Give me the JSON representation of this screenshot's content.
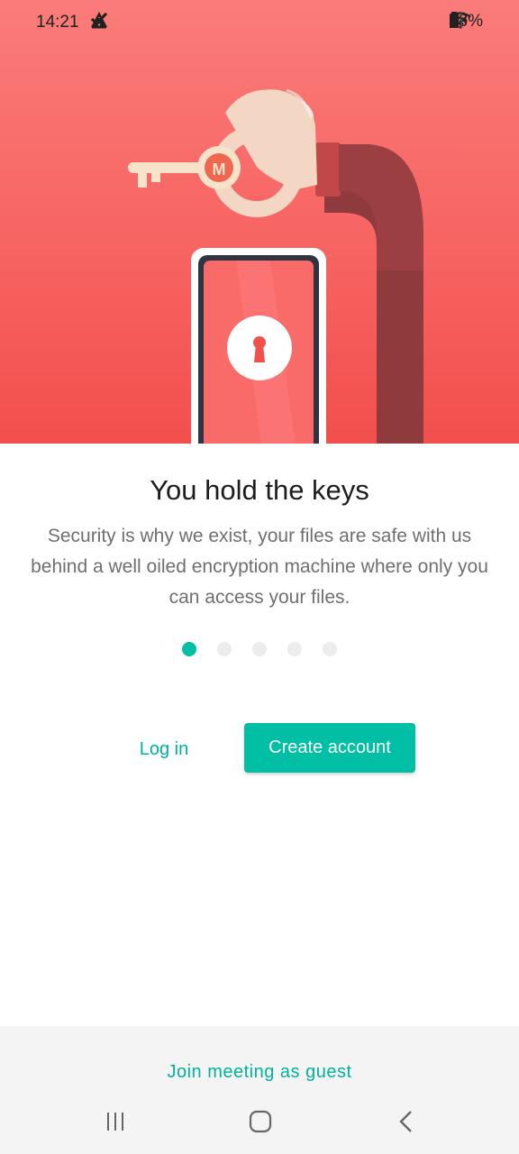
{
  "status_bar": {
    "time": "14:21",
    "left_icons": [
      "download-done-icon",
      "warning-icon",
      "download-done-icon",
      "dot-icon"
    ],
    "right_icons": [
      "mute-icon",
      "wifi-icon",
      "signal-icon"
    ],
    "battery": "58%"
  },
  "hero": {
    "illustration": [
      "key-icon",
      "hand-icon",
      "phone-icon",
      "lock-icon"
    ],
    "logo": "M"
  },
  "onboarding": {
    "title": "You hold the keys",
    "description": "Security is why we exist, your files are safe with us behind a well oiled encryption machine where only you can access your files.",
    "page_count": 5,
    "active_page": 1
  },
  "actions": {
    "login_label": "Log in",
    "create_account_label": "Create account",
    "guest_label": "Join meeting as guest"
  },
  "nav_bar": {
    "buttons": [
      "recent-apps-icon",
      "home-icon",
      "back-icon"
    ]
  },
  "colors": {
    "accent": "#00bfa5",
    "hero_top": "#fa7c7a",
    "hero_bottom": "#f24f4d",
    "arm": "#8f3a3d"
  }
}
